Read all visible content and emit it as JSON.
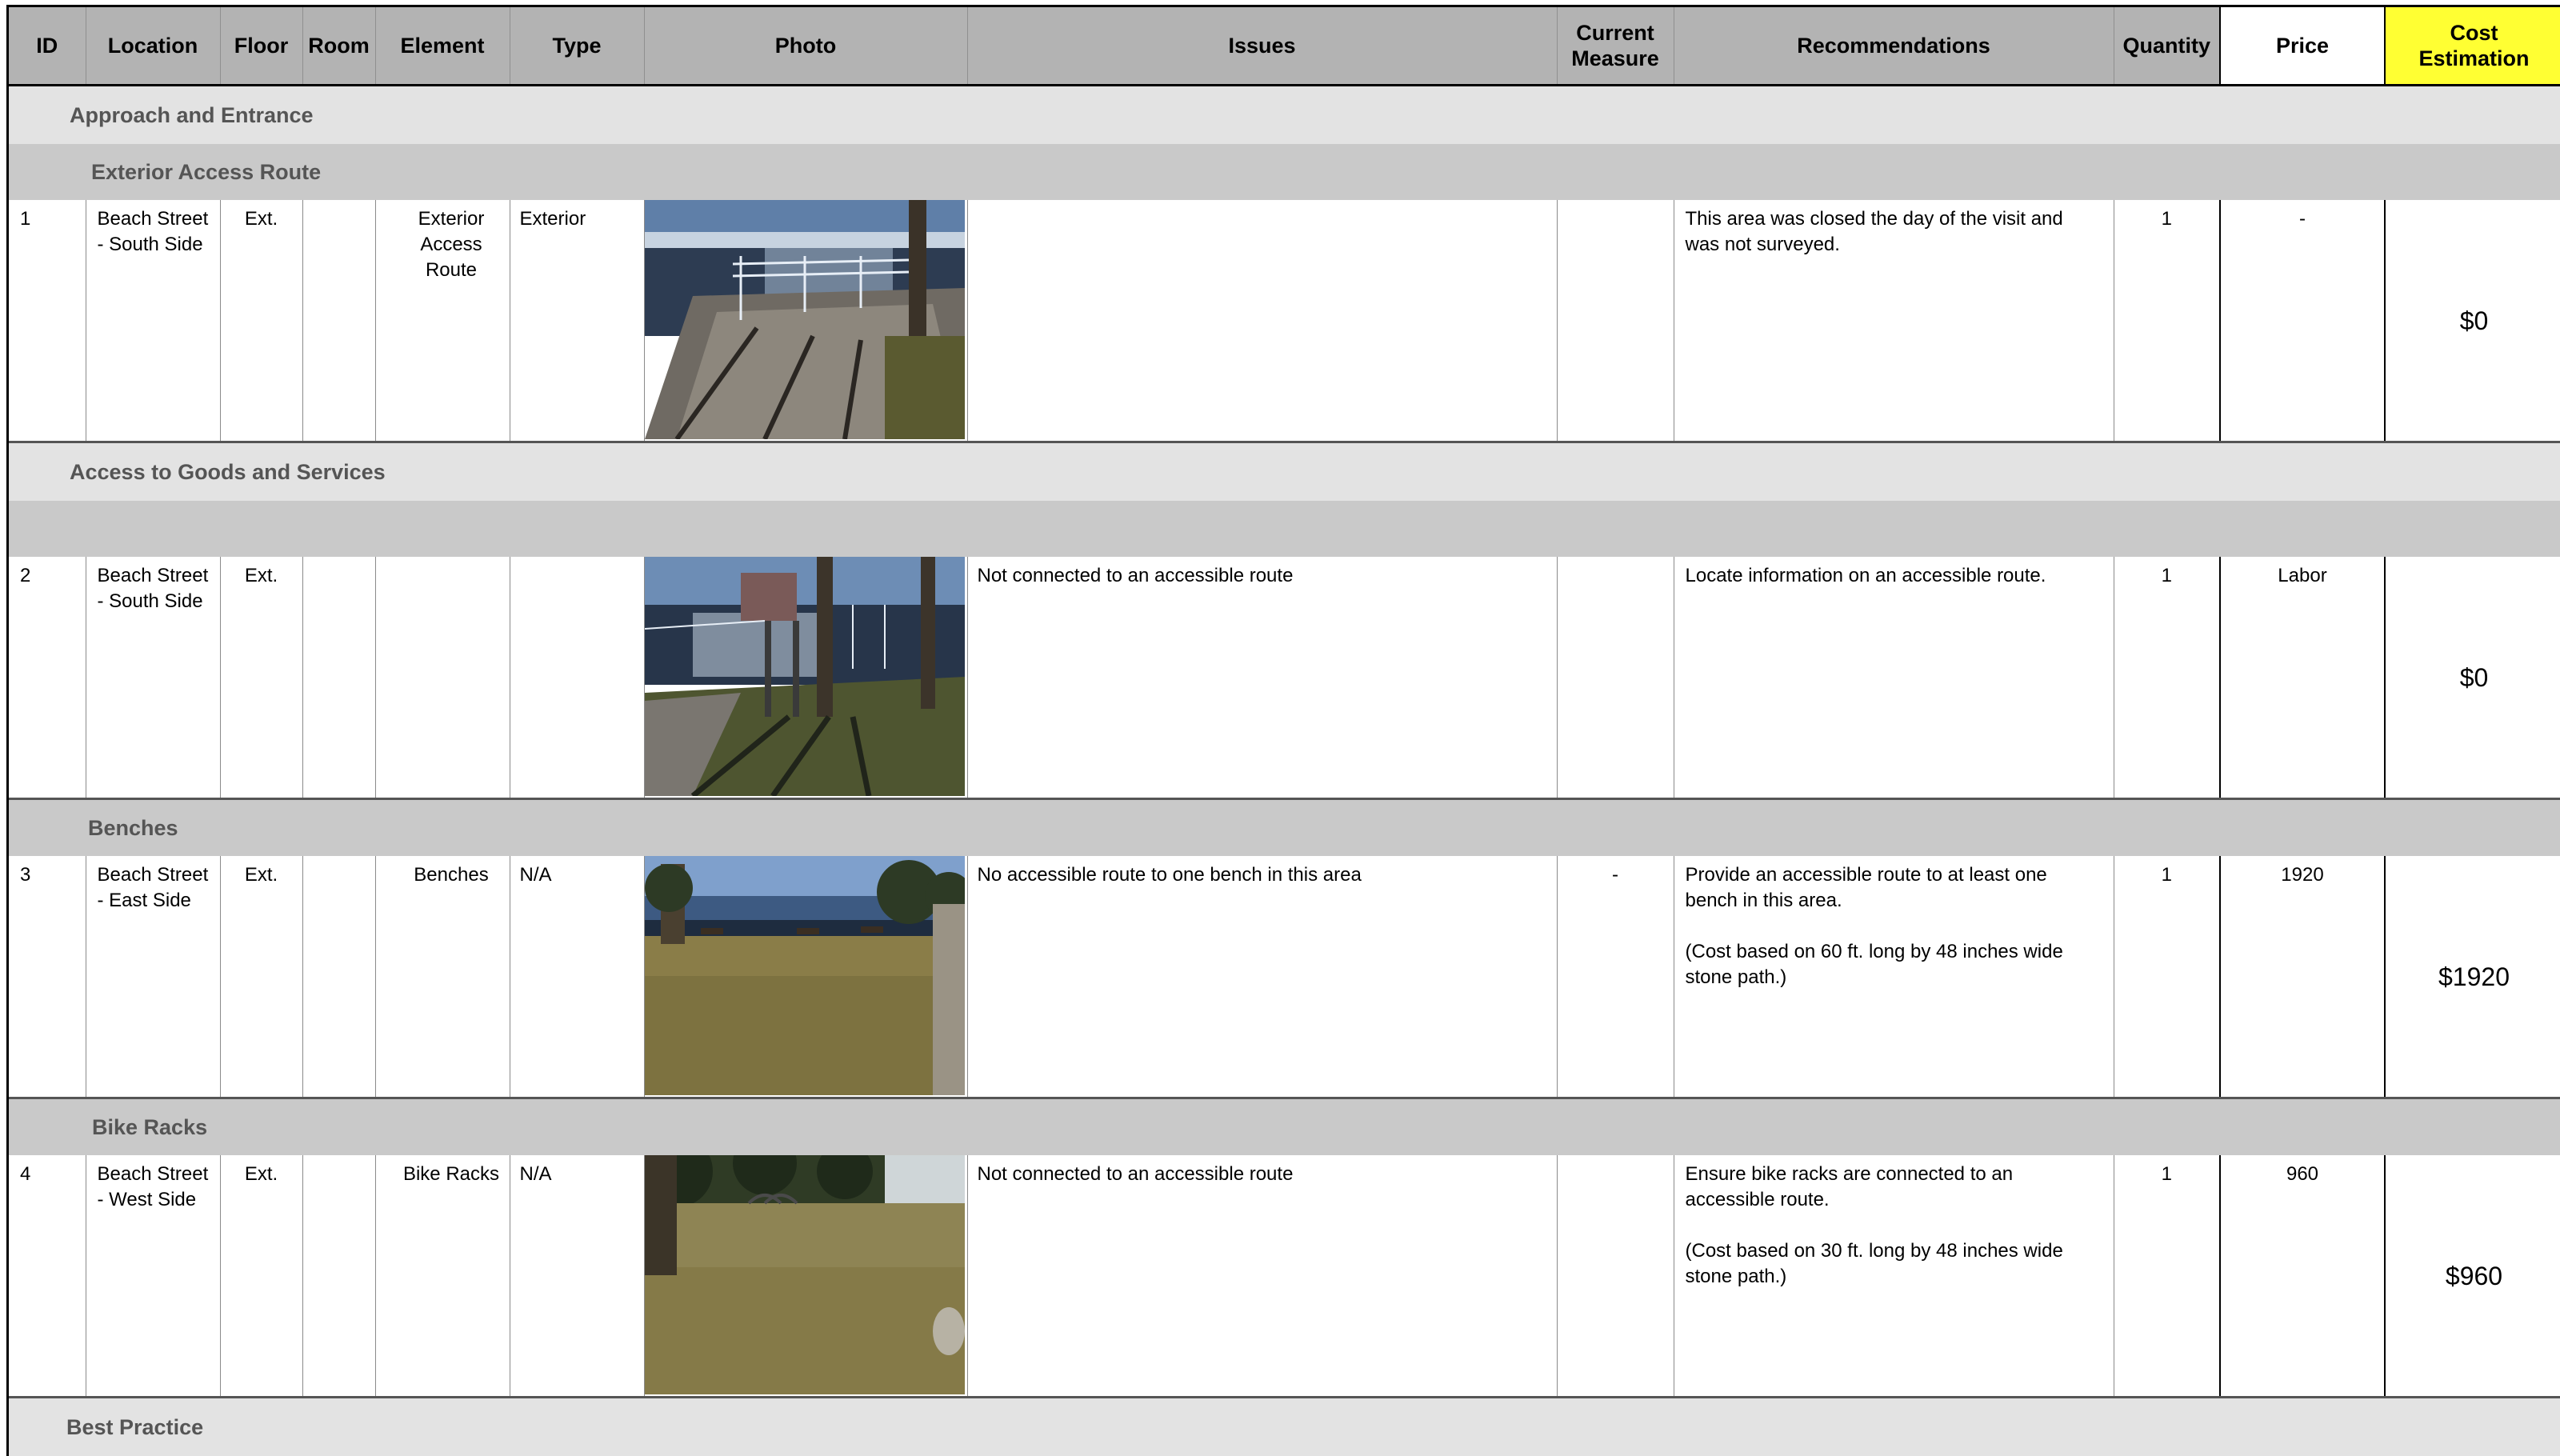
{
  "headers": {
    "id": "ID",
    "location": "Location",
    "floor": "Floor",
    "room": "Room",
    "element": "Element",
    "type": "Type",
    "photo": "Photo",
    "issues": "Issues",
    "current_measure": "Current Measure",
    "recommendations": "Recommendations",
    "quantity": "Quantity",
    "price": "Price",
    "cost_estimation": "Cost Estimation"
  },
  "sections": {
    "approach": "Approach and Entrance",
    "exterior_access": "Exterior Access Route",
    "goods_services": "Access to Goods and Services",
    "blank_sub": "",
    "benches": "Benches",
    "bike_racks": "Bike Racks",
    "best_practice": "Best Practice"
  },
  "rows": [
    {
      "id": "1",
      "location": "Beach Street - South Side",
      "floor": "Ext.",
      "room": "",
      "element": "Exterior Access Route",
      "type": "Exterior",
      "photo_icon": "dock-walkway-photo",
      "issues": "",
      "current_measure": "",
      "recommendations": [
        "This area was closed the day of the visit and was not surveyed."
      ],
      "quantity": "1",
      "price": "-",
      "cost": "$0"
    },
    {
      "id": "2",
      "location": "Beach Street - South Side",
      "floor": "Ext.",
      "room": "",
      "element": "",
      "type": "",
      "photo_icon": "info-sign-photo",
      "issues": "Not connected to an accessible route",
      "current_measure": "",
      "recommendations": [
        "Locate information on an accessible route."
      ],
      "quantity": "1",
      "price": "Labor",
      "cost": "$0"
    },
    {
      "id": "3",
      "location": "Beach Street - East Side",
      "floor": "Ext.",
      "room": "",
      "element": "Benches",
      "type": "N/A",
      "photo_icon": "lawn-benches-photo",
      "issues": "No accessible route to one bench in this area",
      "current_measure": "-",
      "recommendations": [
        "Provide an accessible route to at least one bench in this area.",
        "(Cost based on 60 ft. long by 48 inches wide stone path.)"
      ],
      "quantity": "1",
      "price": "1920",
      "cost": "$1920"
    },
    {
      "id": "4",
      "location": "Beach Street - West Side",
      "floor": "Ext.",
      "room": "",
      "element": "Bike Racks",
      "type": "N/A",
      "photo_icon": "bike-rack-photo",
      "issues": "Not connected to an accessible route",
      "current_measure": "",
      "recommendations": [
        "Ensure bike racks are connected to an accessible route.",
        "(Cost based on 30 ft. long by 48 inches wide stone path.)"
      ],
      "quantity": "1",
      "price": "960",
      "cost": "$960"
    }
  ],
  "colors": {
    "header_bg": "#b3b3b3",
    "section_bg": "#e3e3e3",
    "subsection_bg": "#c9c9c9",
    "cost_header_bg": "#ffff33"
  }
}
